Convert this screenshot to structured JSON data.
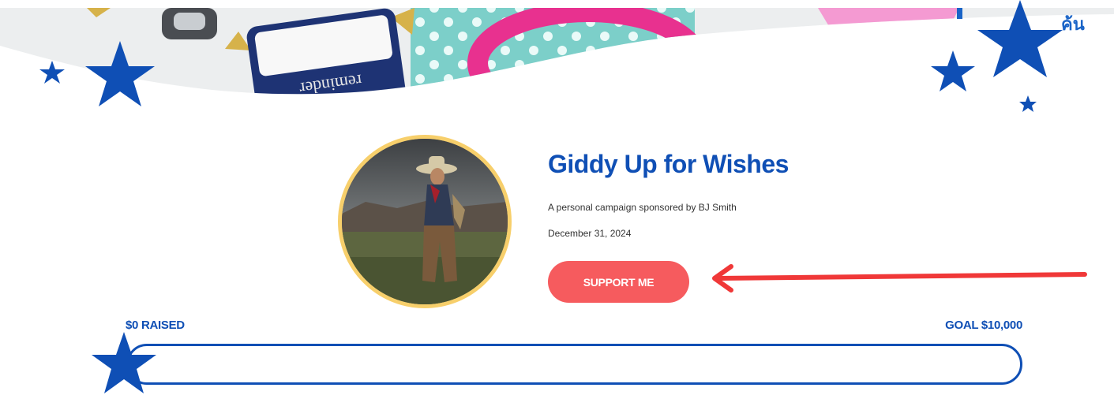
{
  "campaign": {
    "title": "Giddy Up for Wishes",
    "sponsor_text": "A personal campaign sponsored by BJ Smith",
    "date": "December 31, 2024",
    "support_label": "SUPPORT ME"
  },
  "progress": {
    "raised_label": "$0 RAISED",
    "goal_prefix": "GOAL",
    "goal_value": "$10,000",
    "fraction": 0
  },
  "hero": {
    "label_text": "reminder",
    "corner_text": "ค้น"
  },
  "icons": {
    "star": "star-icon",
    "arrow": "arrow-left-icon"
  },
  "colors": {
    "brand_blue": "#0f4fb5",
    "button_coral": "#f65b5e",
    "arrow_red": "#f03838",
    "avatar_ring": "#f7cf6b"
  }
}
